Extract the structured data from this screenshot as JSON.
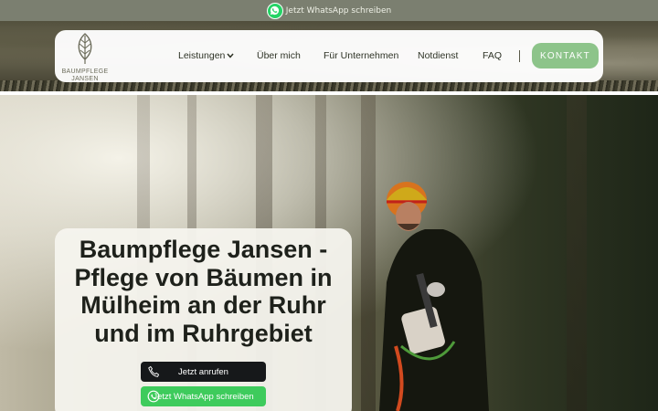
{
  "topbar": {
    "whatsapp_label": "Jetzt WhatsApp schreiben"
  },
  "logo": {
    "line1": "BAUMPFLEGE",
    "line2": "JANSEN"
  },
  "nav": {
    "items": [
      {
        "label": "Leistungen",
        "has_dropdown": true
      },
      {
        "label": "Über mich"
      },
      {
        "label": "Für Unternehmen"
      },
      {
        "label": "Notdienst"
      },
      {
        "label": "FAQ"
      }
    ],
    "cta_label": "KONTAKT"
  },
  "hero": {
    "title": "Baumpflege Jansen - Pflege von Bäumen in Mülheim an der Ruhr und im Ruhrgebiet",
    "call_label": "Jetzt anrufen",
    "whatsapp_label": "Jetzt WhatsApp schreiben"
  },
  "icons": [
    "whatsapp-icon",
    "leaf-logo-icon",
    "chevron-down-icon",
    "phone-icon"
  ],
  "colors": {
    "topbar_bg": "#7b7f70",
    "cta_green": "#8dc48a",
    "whatsapp_green": "#3ecb5c",
    "call_button_bg": "#16181a",
    "text_dark": "#1e211b"
  }
}
